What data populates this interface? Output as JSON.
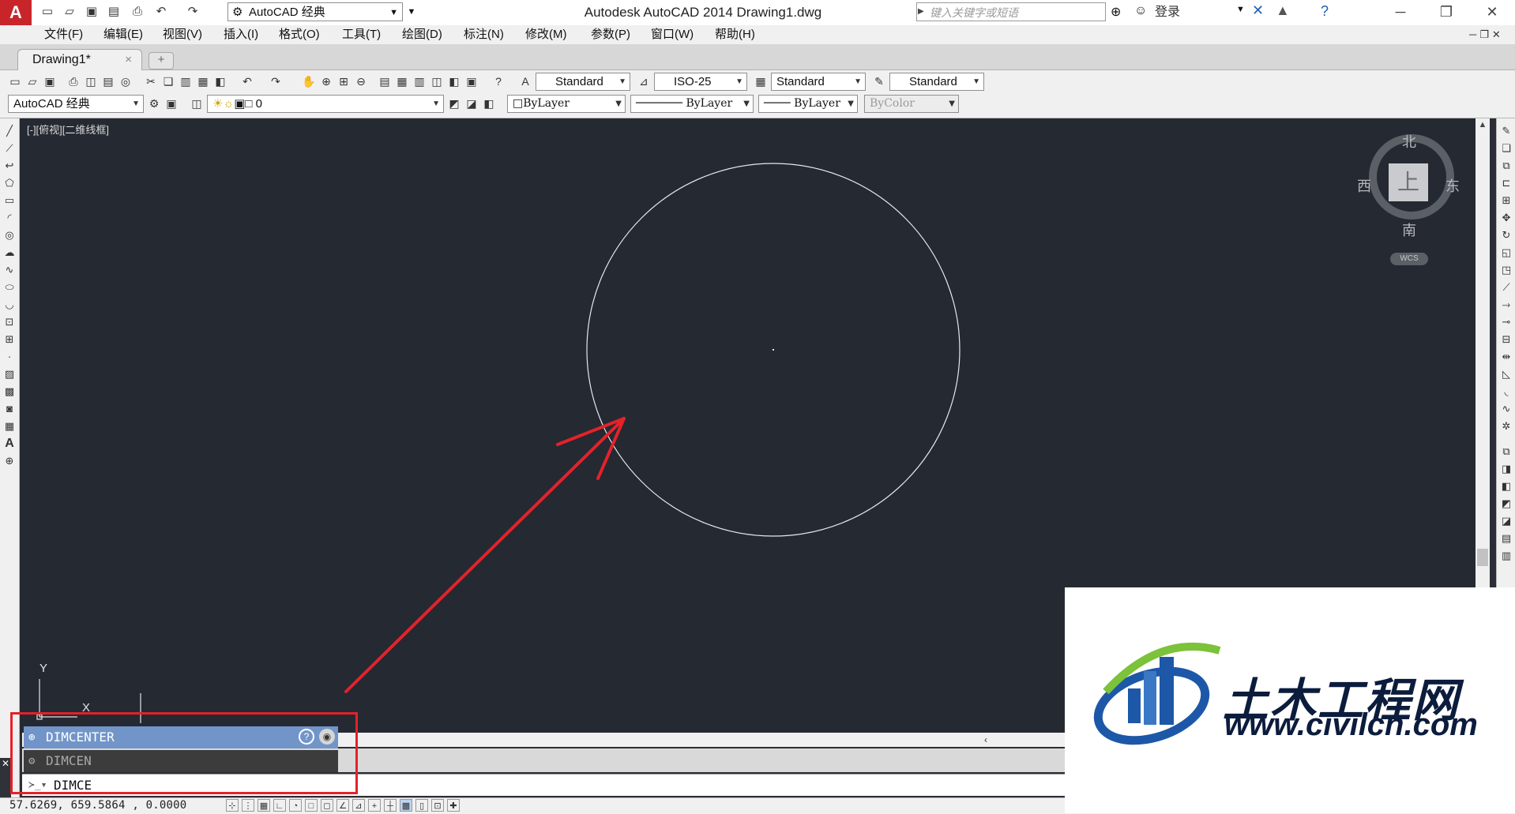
{
  "titlebar": {
    "app_logo": "A",
    "workspace": "AutoCAD 经典",
    "window_title": "Autodesk AutoCAD 2014    Drawing1.dwg",
    "search_placeholder": "键入关键字或短语",
    "login": "登录"
  },
  "menu": {
    "items": [
      "文件(F)",
      "编辑(E)",
      "视图(V)",
      "插入(I)",
      "格式(O)",
      "工具(T)",
      "绘图(D)",
      "标注(N)",
      "修改(M)",
      "参数(P)",
      "窗口(W)",
      "帮助(H)"
    ]
  },
  "tabs": {
    "active": "Drawing1*",
    "close": "×",
    "new": "+"
  },
  "toolbar": {
    "text_style": "Standard",
    "dim_style": "ISO-25",
    "table_style": "Standard",
    "multileader_style": "Standard",
    "workspace": "AutoCAD 经典",
    "layer": "0",
    "color": "ByLayer",
    "linetype": "ByLayer",
    "lineweight": "ByLayer",
    "plot_style": "ByColor"
  },
  "viewport": {
    "label": "[-][俯视][二维线框]"
  },
  "viewcube": {
    "north": "北",
    "south": "南",
    "east": "东",
    "west": "西",
    "face": "上",
    "wcs": "WCS"
  },
  "ucs": {
    "x": "X",
    "y": "Y"
  },
  "command": {
    "history": [
      "DIMCENTER",
      "DIMCEN"
    ],
    "input": "DIMCE"
  },
  "status": {
    "coords": "57.6269,   659.5864 ,  0.0000"
  },
  "watermark": {
    "title": "土木工程网",
    "url": "www.civilcn.com"
  },
  "colors": {
    "canvas": "#252932",
    "annotation": "#e3222a",
    "command_highlight": "#7295c9"
  }
}
